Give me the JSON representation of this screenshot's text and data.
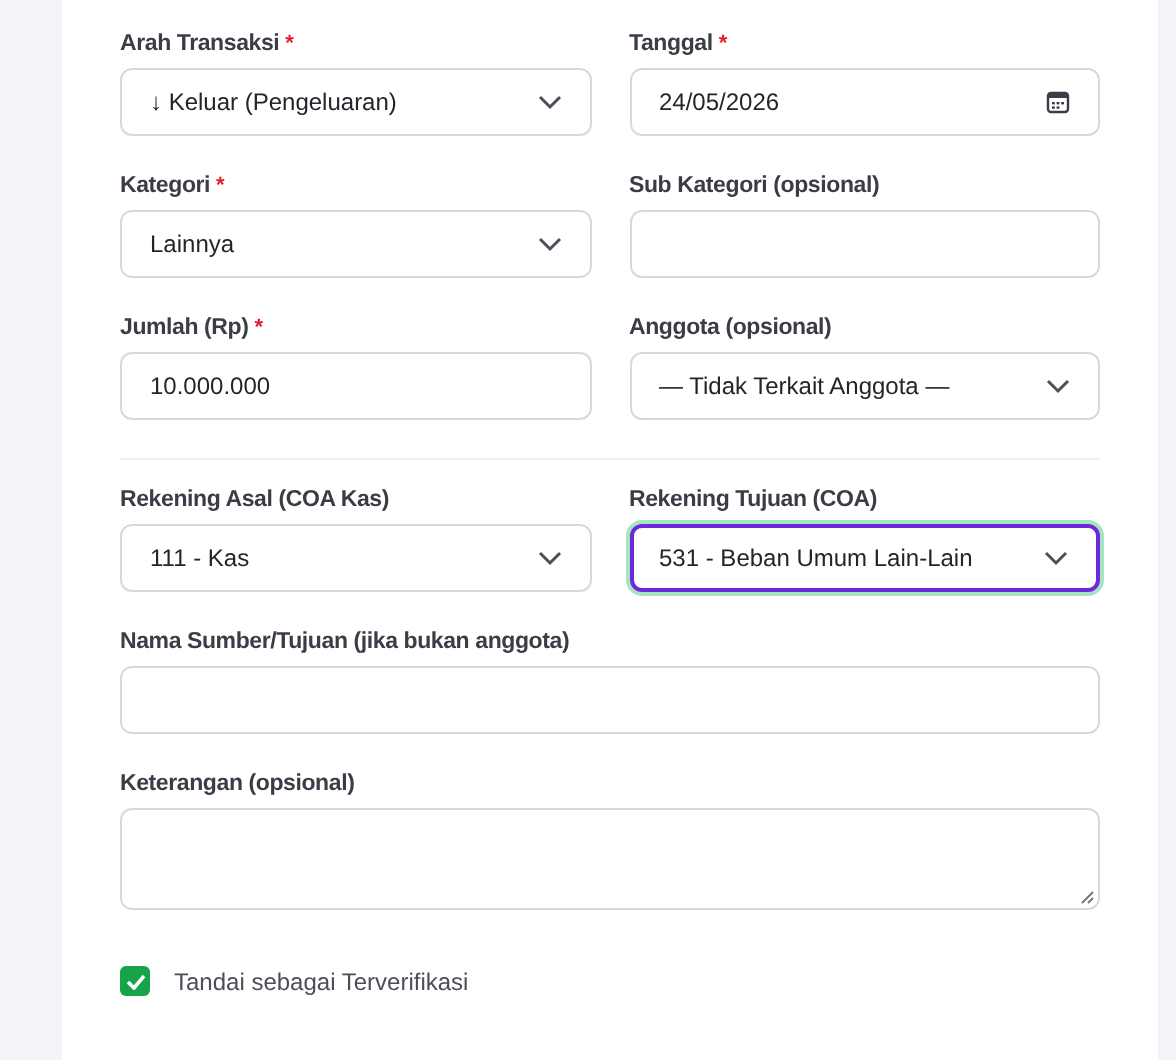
{
  "sections": [
    {
      "fields": [
        {
          "kind": "select",
          "full_width": false,
          "label": "Arah Transaksi",
          "required_mark": "*",
          "value": "↓ Keluar (Pengeluaran)",
          "focused": false
        },
        {
          "kind": "date",
          "full_width": false,
          "label": "Tanggal",
          "required_mark": "*",
          "value": "24/05/2026",
          "focused": false
        },
        {
          "kind": "select",
          "full_width": false,
          "label": "Kategori",
          "required_mark": "*",
          "value": "Lainnya",
          "focused": false
        },
        {
          "kind": "text",
          "full_width": false,
          "label": "Sub Kategori (opsional)",
          "focused": false
        },
        {
          "kind": "text",
          "full_width": false,
          "label": "Jumlah (Rp)",
          "required_mark": "*",
          "value": "10.000.000",
          "focused": false
        },
        {
          "kind": "select",
          "full_width": false,
          "label": "Anggota (opsional)",
          "value": "— Tidak Terkait Anggota —",
          "focused": false
        }
      ]
    },
    {
      "fields": [
        {
          "kind": "select",
          "full_width": false,
          "label": "Rekening Asal (COA Kas)",
          "value": "111 - Kas",
          "focused": false
        },
        {
          "kind": "select",
          "full_width": false,
          "label": "Rekening Tujuan (COA)",
          "value": "531 - Beban Umum Lain-Lain",
          "focused": true
        },
        {
          "kind": "text",
          "full_width": true,
          "label": "Nama Sumber/Tujuan (jika bukan anggota)",
          "focused": false
        },
        {
          "kind": "textarea",
          "full_width": true,
          "label": "Keterangan (opsional)",
          "focused": false
        }
      ]
    }
  ],
  "verified": {
    "label": "Tandai sebagai Terverifikasi",
    "checked": true
  }
}
